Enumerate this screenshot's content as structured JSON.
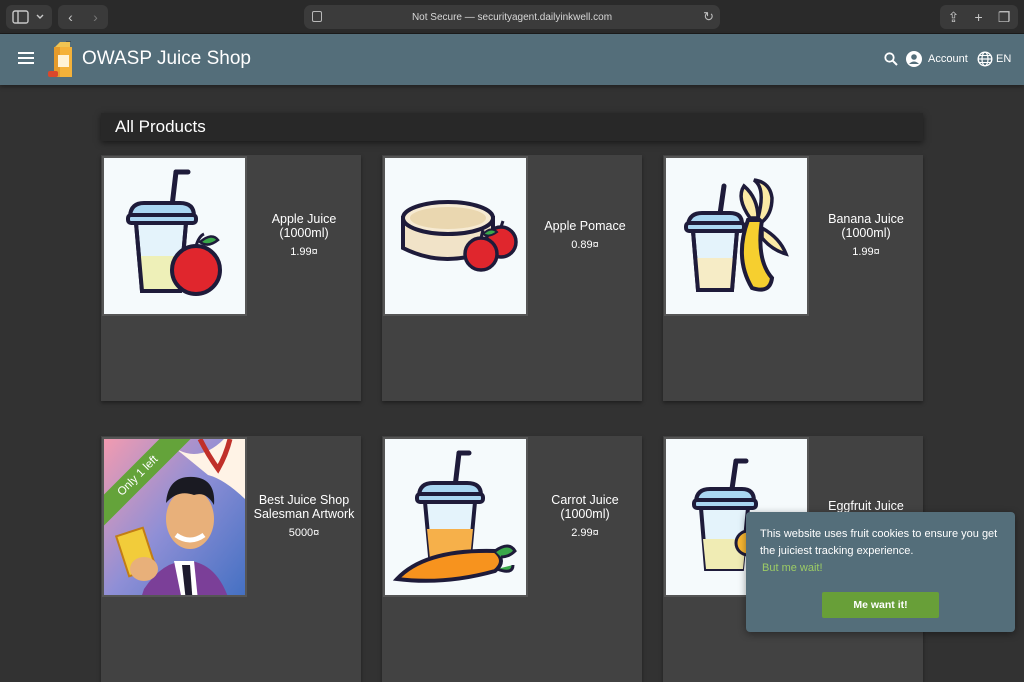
{
  "browser": {
    "url_text": "Not Secure — securityagent.dailyinkwell.com",
    "back_icon": "‹",
    "forward_icon": "›",
    "reload_icon": "↻",
    "share_icon": "⇪",
    "new_tab_icon": "+",
    "tabs_icon": "❐"
  },
  "toolbar": {
    "title": "OWASP Juice Shop",
    "account_label": "Account",
    "language_label": "EN"
  },
  "page": {
    "heading": "All Products"
  },
  "products": [
    {
      "name": "Apple Juice (1000ml)",
      "price": "1.99¤",
      "image": "apple-juice"
    },
    {
      "name": "Apple Pomace",
      "price": "0.89¤",
      "image": "apple-pomace"
    },
    {
      "name": "Banana Juice (1000ml)",
      "price": "1.99¤",
      "image": "banana-juice"
    },
    {
      "name": "Best Juice Shop Salesman Artwork",
      "price": "5000¤",
      "image": "salesman-artwork",
      "ribbon": "Only 1 left"
    },
    {
      "name": "Carrot Juice (1000ml)",
      "price": "2.99¤",
      "image": "carrot-juice"
    },
    {
      "name": "Eggfruit Juice (500ml)",
      "price": "",
      "image": "eggfruit-juice"
    }
  ],
  "cookie": {
    "message": "This website uses fruit cookies to ensure you get the juiciest tracking experience.",
    "link": "But me wait!",
    "button": "Me want it!"
  },
  "colors": {
    "toolbar": "#546e7a",
    "background": "#323232",
    "card": "#424242",
    "accent_green": "#689f38"
  }
}
